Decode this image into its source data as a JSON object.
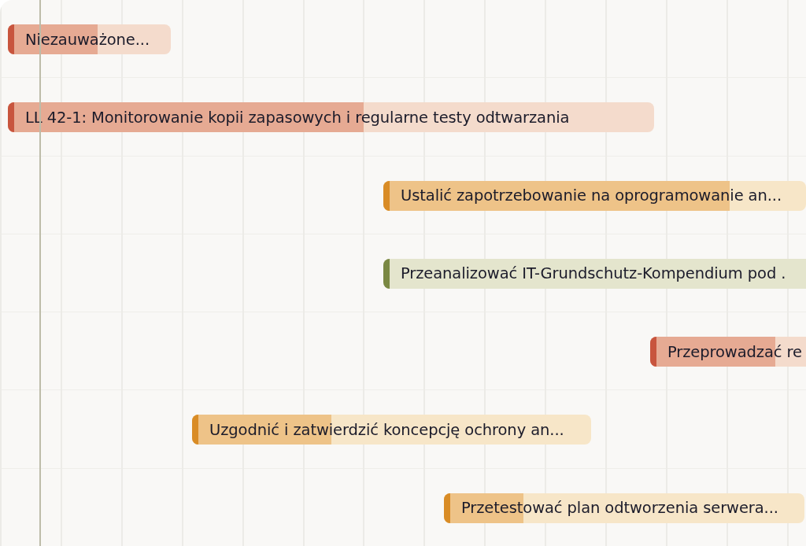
{
  "tasks": [
    {
      "title": "Niezauważone...",
      "color": "#c8553e",
      "level": 0.55
    },
    {
      "title": "LL 42-1: Monitorowanie kopii zapasowych i regularne testy odtwarzania",
      "color": "#c8553e",
      "level": 0.55
    },
    {
      "title": "Ustalić zapotrzebowanie na oprogramowanie an...",
      "color": "#d98c26",
      "level": 0.82
    },
    {
      "title": "Przeanalizować IT-Grundschutz-Kompendium pod .",
      "color": "#7a8843",
      "level": 0
    },
    {
      "title": "Przeprowadzać re",
      "color": "#c8553e",
      "level": 0.77
    },
    {
      "title": "Uzgodnić i zatwierdzić koncepcję ochrony an...",
      "color": "#d98c26",
      "level": 0.35
    },
    {
      "title": "Przetestować plan odtworzenia serwera...",
      "color": "#d98c26",
      "level": 0.22
    }
  ]
}
